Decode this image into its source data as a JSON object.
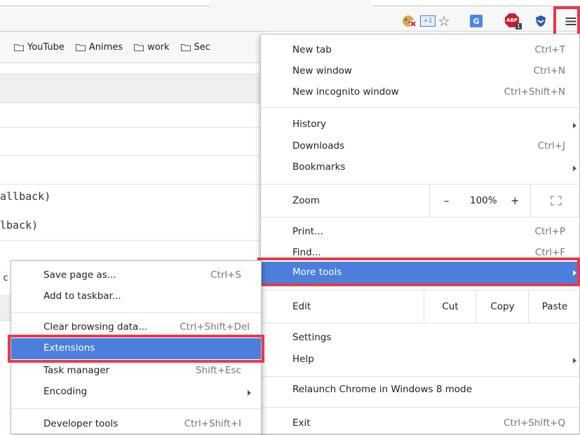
{
  "bookmarks": [
    "YouTube",
    "Animes",
    "work",
    "Sec"
  ],
  "page_code": {
    "line1": "allback)",
    "line2": "lback)",
    "fragment": "c"
  },
  "toolbar": {
    "abp_badge": "ABP",
    "abp_count": "1",
    "translate_glyph": "G",
    "share_glyph": "+1",
    "star_glyph": "☆",
    "menu_glyph": "≡"
  },
  "menu": {
    "new_tab": {
      "label": "New tab",
      "shortcut": "Ctrl+T"
    },
    "new_window": {
      "label": "New window",
      "shortcut": "Ctrl+N"
    },
    "new_incognito": {
      "label": "New incognito window",
      "shortcut": "Ctrl+Shift+N"
    },
    "history": {
      "label": "History"
    },
    "downloads": {
      "label": "Downloads",
      "shortcut": "Ctrl+J"
    },
    "bookmarks": {
      "label": "Bookmarks"
    },
    "zoom": {
      "label": "Zoom",
      "minus": "–",
      "level": "100%",
      "plus": "+"
    },
    "print": {
      "label": "Print...",
      "shortcut": "Ctrl+P"
    },
    "find": {
      "label": "Find...",
      "shortcut": "Ctrl+F"
    },
    "more_tools": {
      "label": "More tools"
    },
    "edit": {
      "label": "Edit",
      "cut": "Cut",
      "copy": "Copy",
      "paste": "Paste"
    },
    "settings": {
      "label": "Settings"
    },
    "help": {
      "label": "Help"
    },
    "relaunch": {
      "label": "Relaunch Chrome in Windows 8 mode"
    },
    "exit": {
      "label": "Exit",
      "shortcut": "Ctrl+Shift+Q"
    }
  },
  "submenu": {
    "save_page": {
      "label": "Save page as...",
      "shortcut": "Ctrl+S"
    },
    "add_taskbar": {
      "label": "Add to taskbar..."
    },
    "clear_data": {
      "label": "Clear browsing data...",
      "shortcut": "Ctrl+Shift+Del"
    },
    "extensions": {
      "label": "Extensions"
    },
    "task_manager": {
      "label": "Task manager",
      "shortcut": "Shift+Esc"
    },
    "encoding": {
      "label": "Encoding"
    },
    "dev_tools": {
      "label": "Developer tools",
      "shortcut": "Ctrl+Shift+I"
    }
  },
  "colors": {
    "highlight": "#4a7fdc",
    "annotation_red": "#e8394a",
    "abp_red": "#c8202f"
  }
}
